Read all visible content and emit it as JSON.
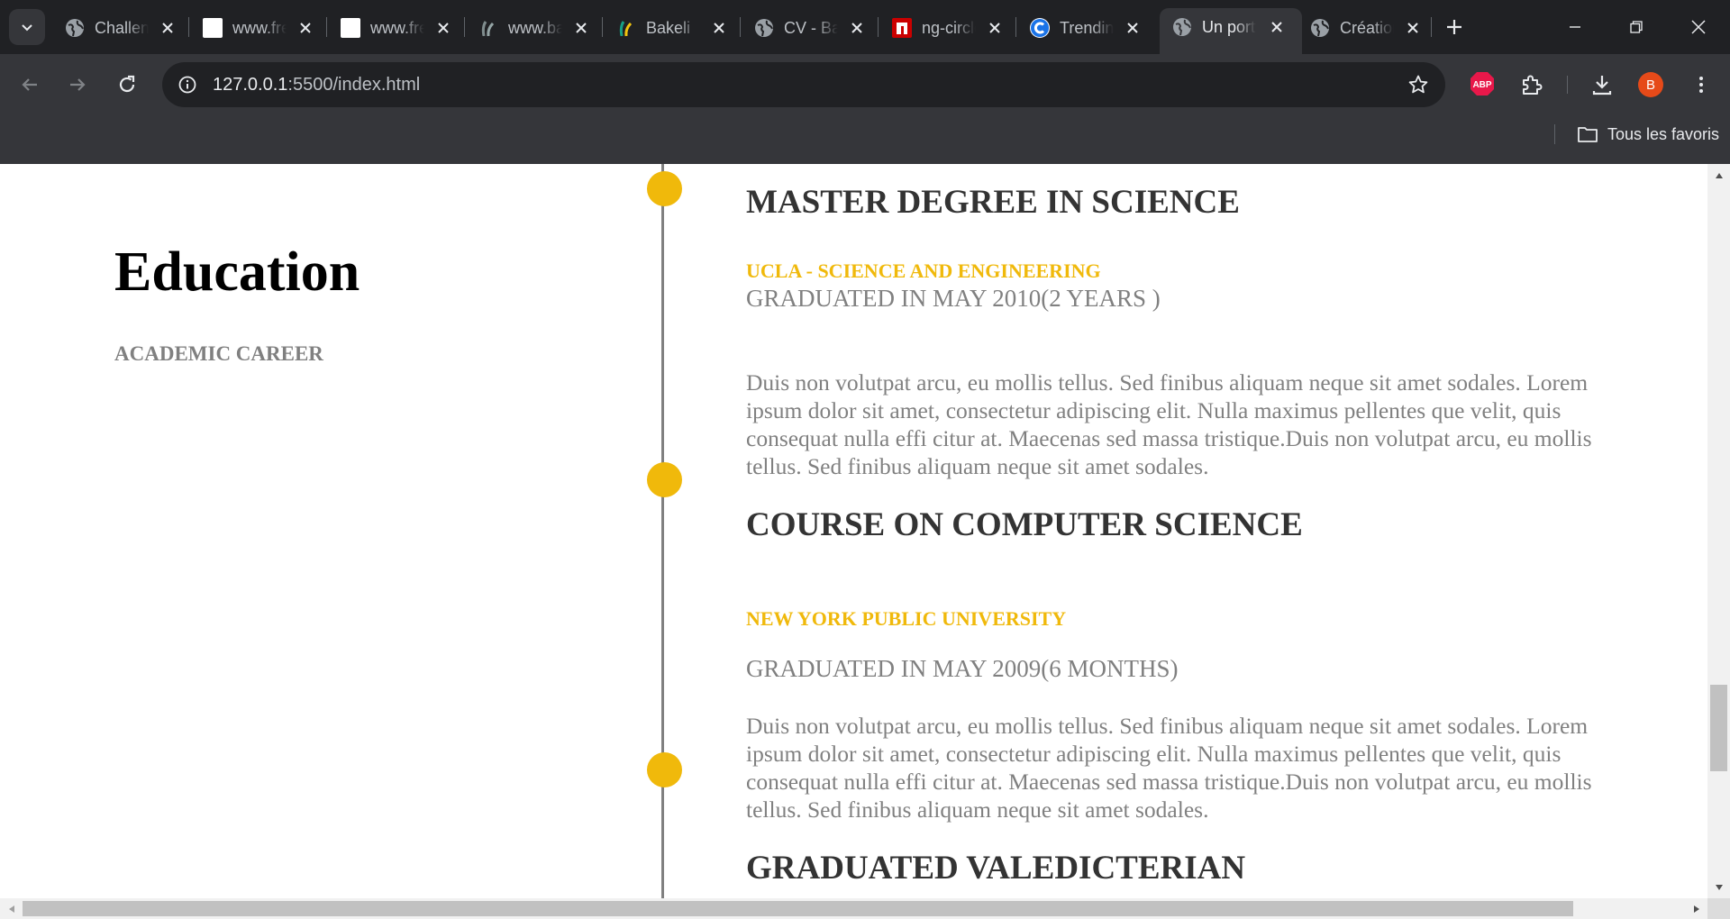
{
  "browser": {
    "tabs": [
      {
        "title": "Challenge",
        "icon": "globe-icon",
        "active": false
      },
      {
        "title": "www.freepik.com",
        "icon": "white-square-icon",
        "active": false
      },
      {
        "title": "www.freepik.com",
        "icon": "white-square-icon",
        "active": false
      },
      {
        "title": "www.bakeli.tech",
        "icon": "bakeli-icon",
        "active": false
      },
      {
        "title": "Bakeli",
        "icon": "bakeli-icon",
        "active": false
      },
      {
        "title": "CV - Bakeli",
        "icon": "globe-icon",
        "active": false
      },
      {
        "title": "ng-circle",
        "icon": "npm-icon",
        "active": false
      },
      {
        "title": "Trending",
        "icon": "c-logo-icon",
        "active": false
      },
      {
        "title": "Un portfolio",
        "icon": "globe-icon",
        "active": true
      },
      {
        "title": "Création",
        "icon": "globe-icon",
        "active": false
      }
    ],
    "url_host": "127.0.0.1",
    "url_path": ":5500/index.html",
    "profile_initial": "B",
    "extension_badge": "ABP",
    "bookmarks_all_label": "Tous les favoris",
    "colors": {
      "accent": "#f0b90b",
      "profile": "#e64a19",
      "abp": "#e8184a"
    }
  },
  "page": {
    "section": {
      "title": "Education",
      "subtitle": "ACADEMIC CAREER"
    },
    "entries": [
      {
        "title": "MASTER DEGREE IN SCIENCE",
        "school": "UCLA - SCIENCE AND ENGINEERING",
        "period": "GRADUATED IN MAY 2010(2 YEARS )",
        "text": "Duis non volutpat arcu, eu mollis tellus. Sed finibus aliquam neque sit amet sodales. Lorem ipsum dolor sit amet, consectetur adipiscing elit. Nulla maximus pellentes que velit, quis consequat nulla effi citur at. Maecenas sed massa tristique.Duis non volutpat arcu, eu mollis tellus. Sed finibus aliquam neque sit amet sodales."
      },
      {
        "title": "COURSE ON COMPUTER SCIENCE",
        "school": "NEW YORK PUBLIC UNIVERSITY",
        "period": "GRADUATED IN MAY 2009(6 MONTHS)",
        "text": "Duis non volutpat arcu, eu mollis tellus. Sed finibus aliquam neque sit amet sodales. Lorem ipsum dolor sit amet, consectetur adipiscing elit. Nulla maximus pellentes que velit, quis consequat nulla effi citur at. Maecenas sed massa tristique.Duis non volutpat arcu, eu mollis tellus. Sed finibus aliquam neque sit amet sodales."
      },
      {
        "title": "GRADUATED VALEDICTERIAN"
      }
    ]
  }
}
